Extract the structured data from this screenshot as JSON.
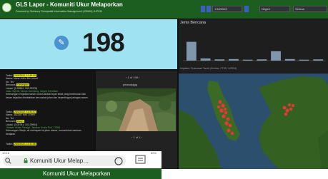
{
  "header": {
    "title": "GLS Lapor - Komuniti Ukur Melaporkan",
    "subtitle": "Powered by Stefanny Geospatial Information Management (IGIMM) JUPEM",
    "date_value": "1/18/2022",
    "region_value": "Negeri",
    "state_value": "Semua"
  },
  "stat": {
    "count": "198",
    "icon": "report-icon"
  },
  "chart": {
    "title": "Jenis Bencana",
    "subtitle": "Kejadian: Penkuasan Tanah (Sumber: PTSS, JUPEM)"
  },
  "chart_data": {
    "type": "bar",
    "title": "Jenis Bencana",
    "categories": [
      "",
      "",
      "",
      "",
      "",
      "",
      "",
      "",
      "",
      ""
    ],
    "values": [
      60,
      7,
      4,
      5,
      3,
      4,
      30,
      5,
      3,
      4
    ],
    "ylim": [
      0,
      100
    ],
    "grid": false
  },
  "entries": [
    {
      "tarikh": "Tarikh:",
      "tarikh_value": "25/3/2022, 11:49:00",
      "nama": "Nama:",
      "nama_value": "Mohd Jefert Bin Johan",
      "no_tel": "No. Tel:",
      "no_tel_value": "",
      "bencana": "Bencana:",
      "bencana_value": "Gelongsor",
      "lokasi": "Lokasi:",
      "lokasi_value": "(2.93562, 102.29378)",
      "place": "Jalan Taji 56, Taman Gemilang, Negeri Sembilan",
      "keterangan": "Keterangan: Kejadian tanah runtuh akibat hujan lebat yang berterusan dan kesan kejadian disebabkan kerusakan jalan dan kepentingan jaringan awam."
    },
    {
      "tarikh": "Tarikh:",
      "tarikh_value": "25/3/2022, 11:31:07",
      "nama": "Nama:",
      "nama_value": "JAZZAT NAT JOHN",
      "no_tel": "No. Tel:",
      "no_tel_value": "",
      "bencana": "Bencana:",
      "bencana_value": "Banjir",
      "lokasi": "Lokasi:",
      "lokasi_value": "(3.00781, 101.29904)",
      "place": "Jabatan Hutan Tenaga, Jabatan Kuala Ruh, 71500",
      "keterangan": "Keterangan: Banjir, air melimpah ke jalan utama, memerlukan bantuan kerajaan."
    },
    {
      "tarikh": "Tarikh:",
      "tarikh_value": "25/3/2022, 11:11:08",
      "nama": "",
      "nama_value": "",
      "no_tel": "",
      "no_tel_value": "",
      "bencana": "",
      "bencana_value": "",
      "lokasi": "",
      "lokasi_value": "",
      "place": "",
      "keterangan": ""
    }
  ],
  "list_pager": "1 of 198",
  "photo": {
    "title": "peanutpjgg",
    "pager": "1 of 1"
  },
  "mobile": {
    "status_time": "10:16",
    "status_right": "60%",
    "url": "Komuniti Ukur Melap…",
    "green_bar": "Komuniti Ukur Melaporkan"
  },
  "colors": {
    "header": "#1b5e20",
    "stat_bg": "#9fe3f3",
    "map_sea": "#2a4e6c",
    "hotspot": "#e53935"
  }
}
